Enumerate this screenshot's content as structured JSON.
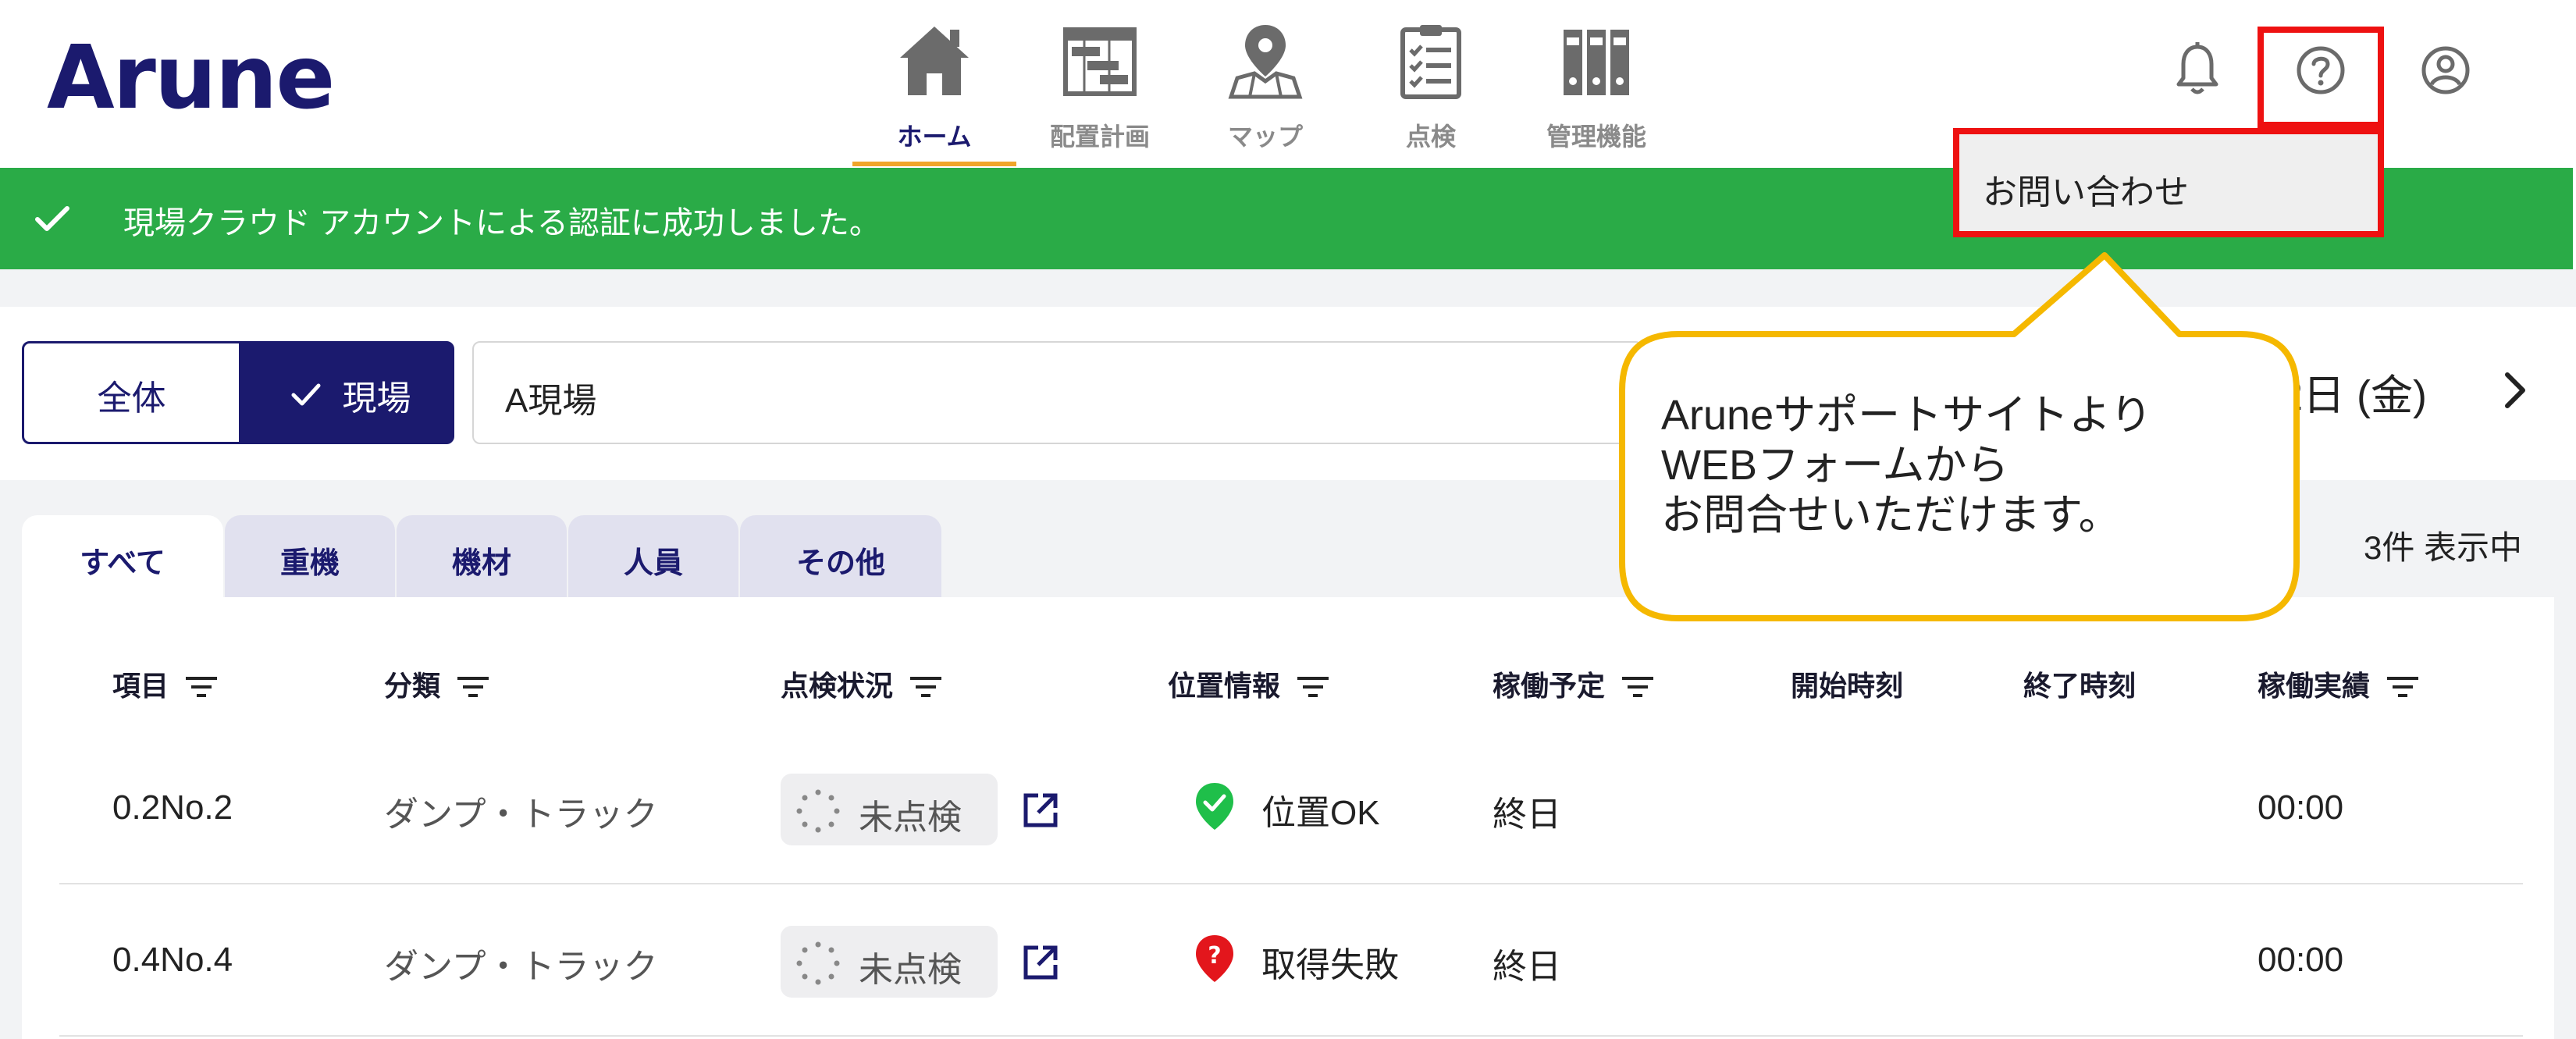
{
  "app": {
    "brand": "Arune"
  },
  "nav": {
    "items": [
      {
        "label": "ホーム",
        "icon": "home-icon",
        "active": true
      },
      {
        "label": "配置計画",
        "icon": "gantt-icon",
        "active": false
      },
      {
        "label": "マップ",
        "icon": "map-icon",
        "active": false
      },
      {
        "label": "点検",
        "icon": "checklist-icon",
        "active": false
      },
      {
        "label": "管理機能",
        "icon": "binder-icon",
        "active": false
      }
    ],
    "active_color": "#1b1a6e",
    "underline_color": "#f0a52a"
  },
  "header_icons": [
    "bell-icon",
    "help-icon",
    "account-icon"
  ],
  "help_menu": {
    "items": [
      "お問い合わせ"
    ]
  },
  "banner": {
    "text": "現場クラウド アカウントによる認証に成功しました。",
    "color": "#2aab47"
  },
  "filter": {
    "scope_all": "全体",
    "scope_site": "現場",
    "site_value": "A現場",
    "date_text": "2日 (金)"
  },
  "tabs": [
    "すべて",
    "重機",
    "機材",
    "人員",
    "その他"
  ],
  "count_text": "3件 表示中",
  "table": {
    "headers": [
      "項目",
      "分類",
      "点検状況",
      "位置情報",
      "稼働予定",
      "開始時刻",
      "終了時刻",
      "稼働実績"
    ],
    "rows": [
      {
        "item": "0.2No.2",
        "category": "ダンプ・トラック",
        "inspection": "未点検",
        "location": "位置OK",
        "location_state": "ok",
        "schedule": "終日",
        "start": "",
        "end": "",
        "actual": "00:00"
      },
      {
        "item": "0.4No.4",
        "category": "ダンプ・トラック",
        "inspection": "未点検",
        "location": "取得失敗",
        "location_state": "error",
        "schedule": "終日",
        "start": "",
        "end": "",
        "actual": "00:00"
      }
    ]
  },
  "callout": {
    "lines": [
      "Aruneサポートサイトより",
      "WEBフォームから",
      "お問合せいただけます。"
    ],
    "border_color": "#f5b800"
  },
  "highlight_color": "#ee1111"
}
